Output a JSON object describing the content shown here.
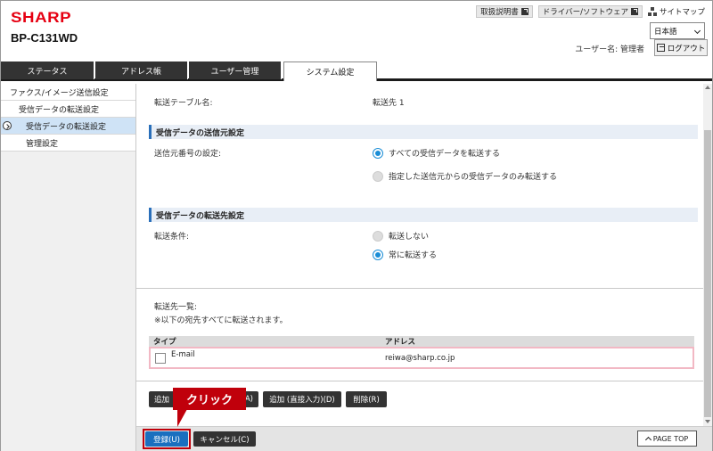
{
  "header": {
    "logo": "SHARP",
    "model": "BP-C131WD",
    "links": [
      {
        "label": "取扱説明書"
      },
      {
        "label": "ドライバー/ソフトウェア"
      }
    ],
    "sitemap": "サイトマップ",
    "language": "日本語",
    "username": "ユーザー名: 管理者",
    "logout": "ログアウト"
  },
  "tabs": [
    {
      "label": "ステータス"
    },
    {
      "label": "アドレス帳"
    },
    {
      "label": "ユーザー管理"
    },
    {
      "label": "システム設定"
    }
  ],
  "sidebar": {
    "items": [
      {
        "label": "ファクス/イメージ送信設定"
      },
      {
        "label": "受信データの転送設定"
      },
      {
        "label": "受信データの転送設定"
      },
      {
        "label": "管理設定"
      }
    ]
  },
  "main": {
    "table_name_label": "転送テーブル名:",
    "table_name_value": "転送先 1",
    "section1": {
      "title": "受信データの送信元設定",
      "label": "送信元番号の設定:",
      "options": [
        "すべての受信データを転送する",
        "指定した送信元からの受信データのみ転送する"
      ],
      "selected": 0
    },
    "section2": {
      "title": "受信データの転送先設定",
      "label": "転送条件:",
      "options": [
        "転送しない",
        "常に転送する"
      ],
      "selected": 1
    },
    "dest_list_label": "転送先一覧:",
    "dest_list_note": "※以下の宛先すべてに転送されます。",
    "dest_table": {
      "headers": [
        "タイプ",
        "アドレス"
      ],
      "rows": [
        {
          "type": "E-mail",
          "address": "reiwa@sharp.co.jp"
        }
      ]
    },
    "buttons": {
      "add_addressbook": "追加",
      "add_addressbook_suffix": "A)",
      "add_direct": "追加 (直接入力)(D)",
      "delete": "削除(R)"
    }
  },
  "footer": {
    "submit": "登録(U)",
    "cancel": "キャンセル(C)",
    "page_top": "PAGE TOP"
  },
  "callout": {
    "text": "クリック"
  },
  "colors": {
    "brand_red": "#e60012",
    "accent_blue": "#1a8dd6",
    "callout_red": "#c0000b"
  }
}
